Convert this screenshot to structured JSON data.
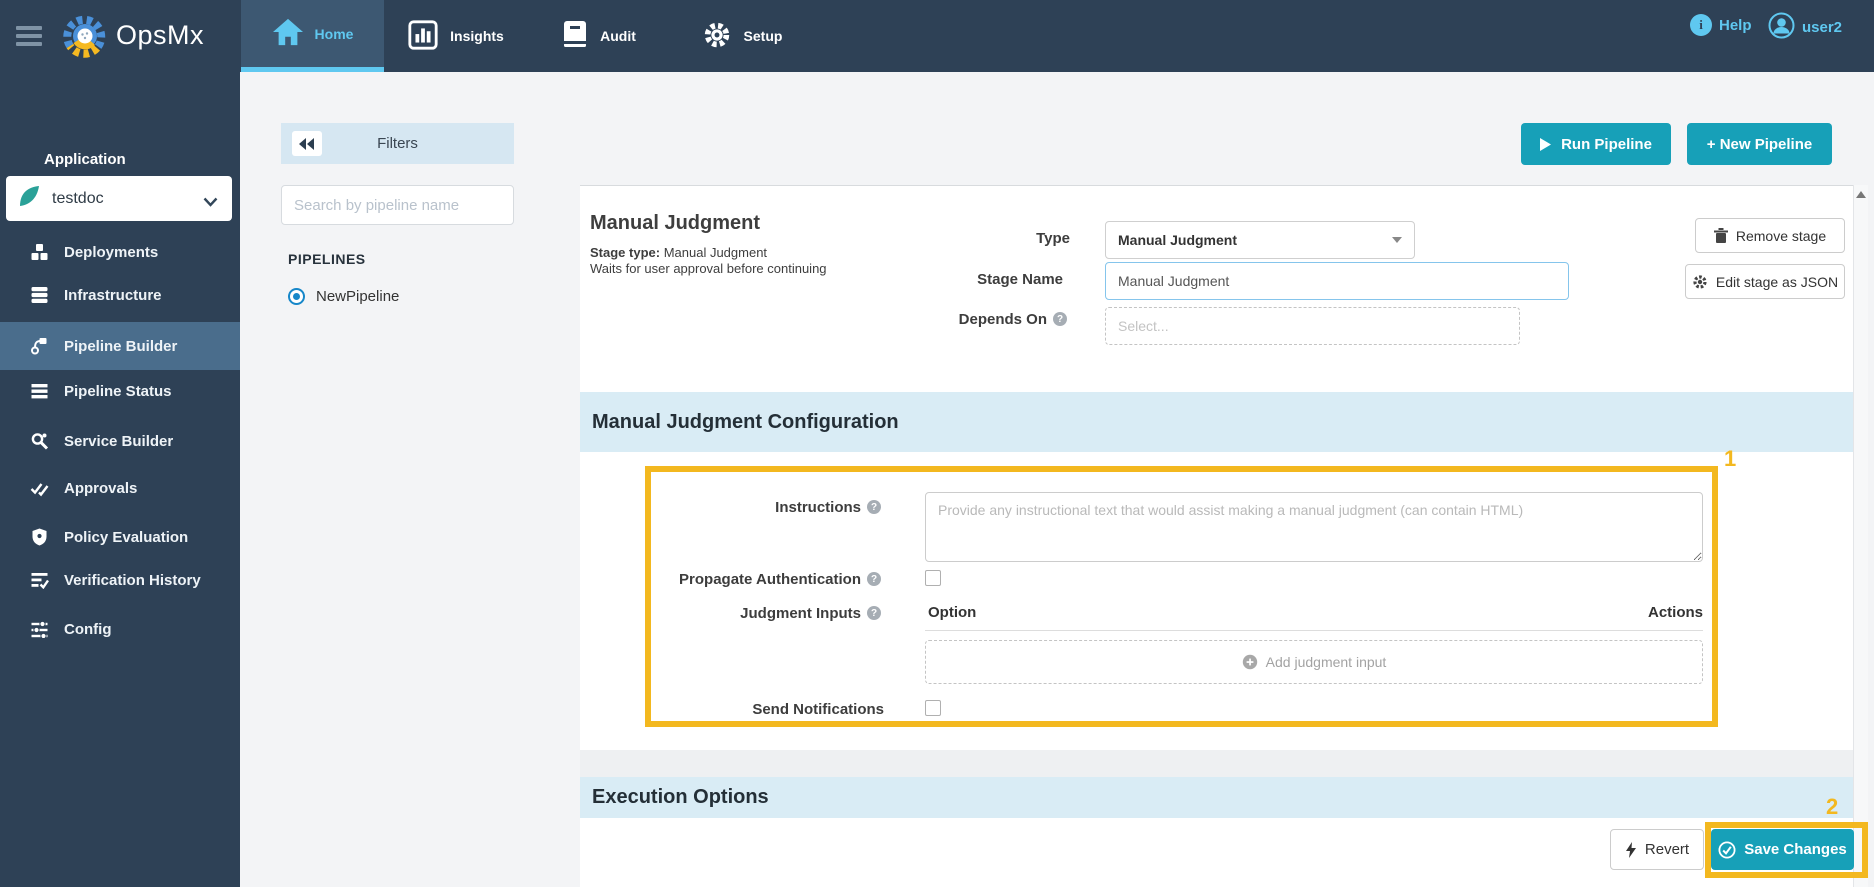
{
  "topbar": {
    "brand": "OpsMx",
    "tabs": [
      {
        "label": "Home",
        "active": true
      },
      {
        "label": "Insights",
        "active": false
      },
      {
        "label": "Audit",
        "active": false
      },
      {
        "label": "Setup",
        "active": false
      }
    ],
    "help": "Help",
    "user": "user2"
  },
  "sidebar": {
    "section": "Application",
    "application": "testdoc",
    "items": [
      {
        "label": "Deployments",
        "active": false
      },
      {
        "label": "Infrastructure",
        "active": false
      },
      {
        "label": "Pipeline Builder",
        "active": true
      },
      {
        "label": "Pipeline Status",
        "active": false
      },
      {
        "label": "Service Builder",
        "active": false
      },
      {
        "label": "Approvals",
        "active": false
      },
      {
        "label": "Policy Evaluation",
        "active": false
      },
      {
        "label": "Verification History",
        "active": false
      },
      {
        "label": "Config",
        "active": false
      }
    ]
  },
  "filters": {
    "title": "Filters",
    "search_placeholder": "Search by pipeline name",
    "pipelines_header": "PIPELINES",
    "pipeline_name": "NewPipeline"
  },
  "toolbar": {
    "run_pipeline": "Run Pipeline",
    "new_pipeline": "+ New Pipeline"
  },
  "stage": {
    "title": "Manual Judgment",
    "stage_type_label": "Stage type:",
    "stage_type_value": " Manual Judgment",
    "description": "Waits for user approval before continuing",
    "type_label": "Type",
    "type_value": "Manual Judgment",
    "stage_name_label": "Stage Name",
    "stage_name_value": "Manual Judgment",
    "depends_on_label": "Depends On",
    "depends_on_placeholder": "Select...",
    "remove_stage_label": "Remove stage",
    "edit_json_label": "Edit stage as JSON"
  },
  "judgment_config": {
    "title": "Manual Judgment Configuration",
    "instructions_label": "Instructions",
    "instructions_placeholder": "Provide any instructional text that would assist making a manual judgment (can contain HTML)",
    "propagate_label": "Propagate Authentication",
    "judgment_inputs_label": "Judgment Inputs",
    "option_header": "Option",
    "actions_header": "Actions",
    "add_input_label": "Add judgment input",
    "send_notifications_label": "Send Notifications"
  },
  "execution": {
    "title": "Execution Options"
  },
  "footer": {
    "revert": "Revert",
    "save": "Save Changes"
  },
  "annotations": {
    "box1": "1",
    "box2": "2"
  },
  "colors": {
    "topbar": "#2e4156",
    "accent_teal": "#17a0b8",
    "tab_highlight": "#5fc8f0",
    "annotation_yellow": "#f3b81f",
    "section_band": "#d9ecf5",
    "sidebar_active": "#4a6d8c"
  }
}
